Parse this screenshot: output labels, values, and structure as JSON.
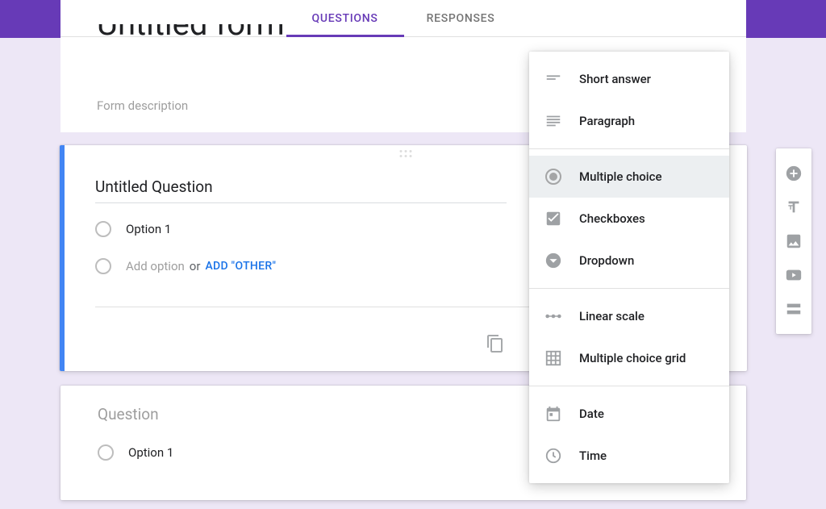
{
  "tabs": {
    "questions": "QUESTIONS",
    "responses": "RESPONSES"
  },
  "form": {
    "title_truncated": "Untitled form",
    "description_placeholder": "Form description"
  },
  "active_question": {
    "title": "Untitled Question",
    "option1": "Option 1",
    "add_option_placeholder": "Add option",
    "or_text": "or",
    "add_other_link": "ADD \"OTHER\""
  },
  "inactive_question": {
    "title": "Question",
    "option1": "Option 1"
  },
  "question_type_menu": {
    "short_answer": "Short answer",
    "paragraph": "Paragraph",
    "multiple_choice": "Multiple choice",
    "checkboxes": "Checkboxes",
    "dropdown": "Dropdown",
    "linear_scale": "Linear scale",
    "multiple_choice_grid": "Multiple choice grid",
    "date": "Date",
    "time": "Time"
  },
  "sidebar": {
    "add_question": "Add question",
    "add_title": "Add title and description",
    "add_image": "Add image",
    "add_video": "Add video",
    "add_section": "Add section"
  }
}
